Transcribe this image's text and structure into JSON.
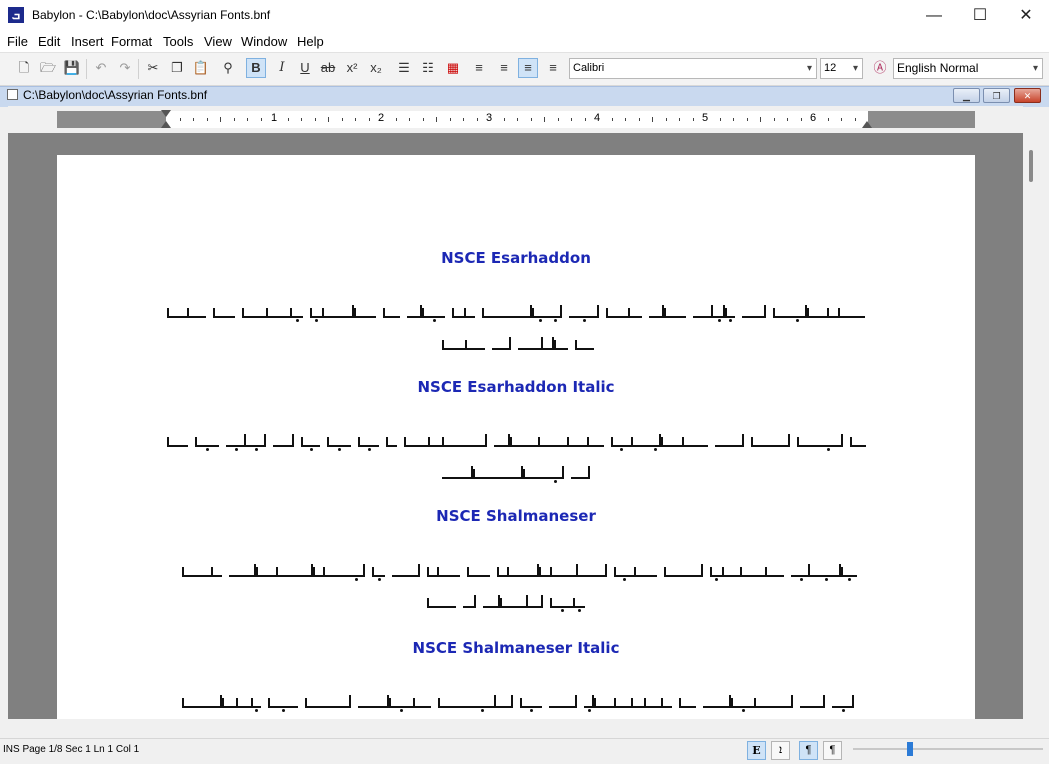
{
  "window": {
    "title": "Babylon - C:\\Babylon\\doc\\Assyrian Fonts.bnf",
    "app_icon_glyph": "ܒ"
  },
  "menu": [
    "File",
    "Edit",
    "Insert",
    "Format",
    "Tools",
    "View",
    "Window",
    "Help"
  ],
  "toolbar": {
    "bold": "B",
    "italic": "I",
    "underline": "U",
    "strike": "ab",
    "superscript": "x²",
    "subscript": "x₂",
    "font_name": "Calibri",
    "font_size": "12",
    "style": "English Normal"
  },
  "document": {
    "child_title": "C:\\Babylon\\doc\\Assyrian Fonts.bnf",
    "ruler_numbers": [
      "1",
      "2",
      "3",
      "4",
      "5",
      "6"
    ],
    "headings": [
      "NSCE Esarhaddon",
      "NSCE Esarhaddon Italic",
      "NSCE Shalmaneser",
      "NSCE Shalmaneser Italic"
    ]
  },
  "status": {
    "text": "INS  Page 1/8  Sec 1  Ln 1 Col 1",
    "btn_e": "E",
    "btn_syr": "ܐ",
    "btn_ltr": "¶",
    "btn_rtl": "¶"
  },
  "colors": {
    "heading": "#1c28b4",
    "accent": "#2c7bd6"
  },
  "icons": [
    "new-doc-icon",
    "open-icon",
    "save-icon",
    "undo-icon",
    "redo-icon",
    "cut-icon",
    "copy-icon",
    "paste-icon",
    "find-icon",
    "bullet-list-icon",
    "numbered-list-icon",
    "color-icon",
    "align-left-icon",
    "align-center-icon",
    "align-justify-icon",
    "align-right-icon",
    "style-icon",
    "minimize-icon",
    "maximize-icon",
    "close-icon"
  ]
}
